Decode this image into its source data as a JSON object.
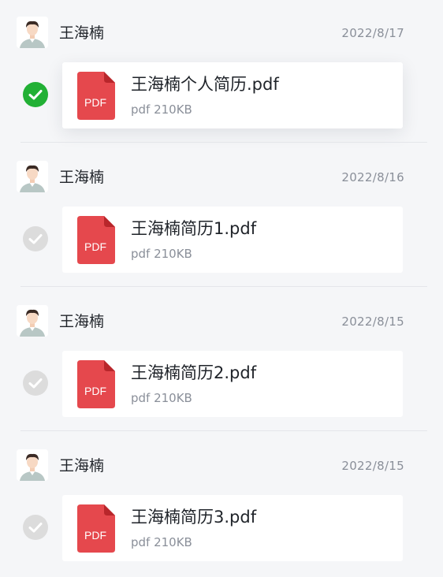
{
  "colors": {
    "background": "#f5f6f8",
    "card": "#ffffff",
    "check_selected": "#22b035",
    "check_unselected": "#dcdcdc",
    "pdf_red": "#e5484d",
    "secondary_text": "#8a8f99"
  },
  "messages": [
    {
      "sender": "王海楠",
      "date": "2022/8/17",
      "selected": true,
      "file": {
        "name": "王海楠个人简历.pdf",
        "meta": "pdf 210KB",
        "icon_label": "PDF"
      }
    },
    {
      "sender": "王海楠",
      "date": "2022/8/16",
      "selected": false,
      "file": {
        "name": "王海楠简历1.pdf",
        "meta": "pdf 210KB",
        "icon_label": "PDF"
      }
    },
    {
      "sender": "王海楠",
      "date": "2022/8/15",
      "selected": false,
      "file": {
        "name": "王海楠简历2.pdf",
        "meta": "pdf 210KB",
        "icon_label": "PDF"
      }
    },
    {
      "sender": "王海楠",
      "date": "2022/8/15",
      "selected": false,
      "file": {
        "name": "王海楠简历3.pdf",
        "meta": "pdf 210KB",
        "icon_label": "PDF"
      }
    }
  ]
}
